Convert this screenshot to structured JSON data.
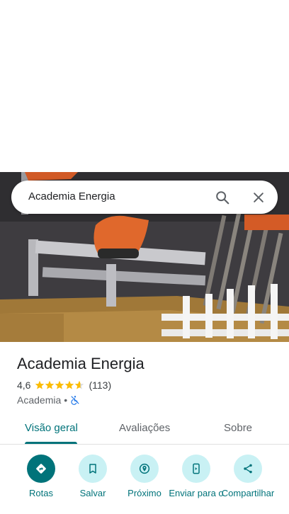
{
  "search": {
    "query": "Academia Energia"
  },
  "place": {
    "name": "Academia Energia",
    "rating": "4,6",
    "rating_value": 4.6,
    "review_count": "(113)",
    "category": "Academia",
    "separator": "•"
  },
  "tabs": [
    {
      "label": "Visão geral",
      "active": true
    },
    {
      "label": "Avaliações",
      "active": false
    },
    {
      "label": "Sobre",
      "active": false
    }
  ],
  "actions": [
    {
      "label": "Rotas",
      "icon": "directions-icon"
    },
    {
      "label": "Salvar",
      "icon": "bookmark-icon"
    },
    {
      "label": "Próximo",
      "icon": "nearby-icon"
    },
    {
      "label": "Enviar para o",
      "icon": "send-to-phone-icon"
    },
    {
      "label": "Compartilhar",
      "icon": "share-icon"
    }
  ],
  "colors": {
    "accent": "#00737a",
    "action_bg": "#c9f1f4",
    "star": "#fbbc04",
    "wheelchair_icon": "#1a73e8"
  }
}
